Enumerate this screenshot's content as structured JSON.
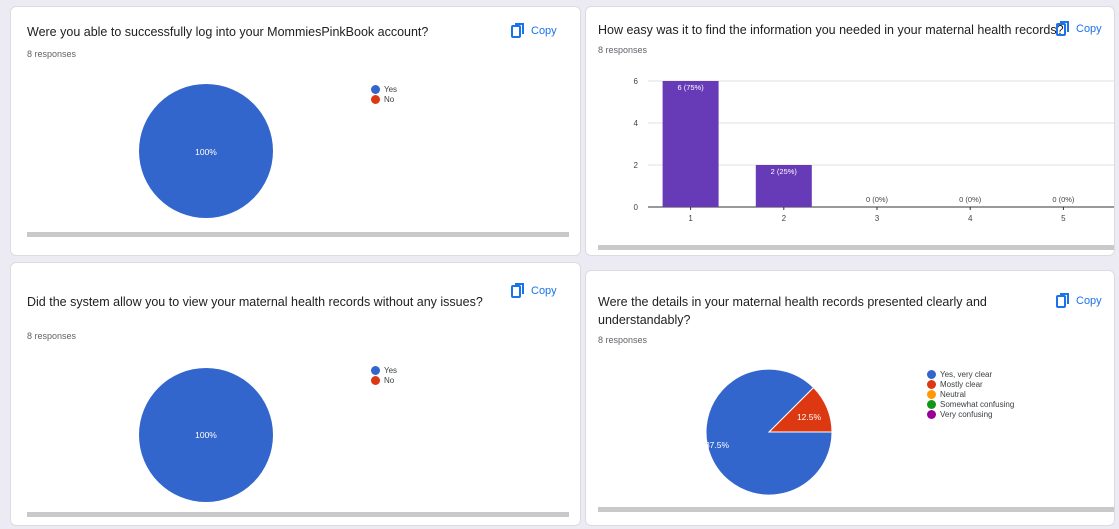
{
  "copy_label": "Copy",
  "colors": {
    "blue": "#3366cc",
    "red": "#dc3912",
    "orange": "#ff9900",
    "green": "#109618",
    "purple": "#990099",
    "bar": "#673ab7",
    "accent": "#1a73e8"
  },
  "q1": {
    "title": "Were you able to successfully log into your MommiesPinkBook account?",
    "responses": "8 responses",
    "legend": [
      "Yes",
      "No"
    ],
    "slice_label": "100%"
  },
  "q2": {
    "title": "How easy was it to find the information you needed in your maternal health records?",
    "responses": "8 responses"
  },
  "q3": {
    "title": "Did the system allow you to view your maternal health records without any issues?",
    "responses": "8 responses",
    "legend": [
      "Yes",
      "No"
    ],
    "slice_label": "100%"
  },
  "q4": {
    "title_line1": "Were the details in your maternal health records presented clearly and",
    "title_line2": "understandably?",
    "responses": "8 responses",
    "legend": [
      "Yes, very clear",
      "Mostly clear",
      "Neutral",
      "Somewhat confusing",
      "Very confusing"
    ],
    "label_large": "87.5%",
    "label_small": "12.5%"
  },
  "chart_data": [
    {
      "type": "pie",
      "categories": [
        "Yes",
        "No"
      ],
      "values": [
        100,
        0
      ],
      "labels": [
        "100%",
        ""
      ]
    },
    {
      "type": "bar",
      "categories": [
        "1",
        "2",
        "3",
        "4",
        "5"
      ],
      "values": [
        6,
        2,
        0,
        0,
        0
      ],
      "data_labels": [
        "6 (75%)",
        "2 (25%)",
        "0 (0%)",
        "0 (0%)",
        "0 (0%)"
      ],
      "yticks": [
        "0",
        "2",
        "4",
        "6"
      ],
      "ylim": [
        0,
        6
      ]
    },
    {
      "type": "pie",
      "categories": [
        "Yes",
        "No"
      ],
      "values": [
        100,
        0
      ],
      "labels": [
        "100%",
        ""
      ]
    },
    {
      "type": "pie",
      "categories": [
        "Yes, very clear",
        "Mostly clear",
        "Neutral",
        "Somewhat confusing",
        "Very confusing"
      ],
      "values": [
        87.5,
        12.5,
        0,
        0,
        0
      ],
      "labels": [
        "87.5%",
        "12.5%",
        "",
        "",
        ""
      ]
    }
  ]
}
